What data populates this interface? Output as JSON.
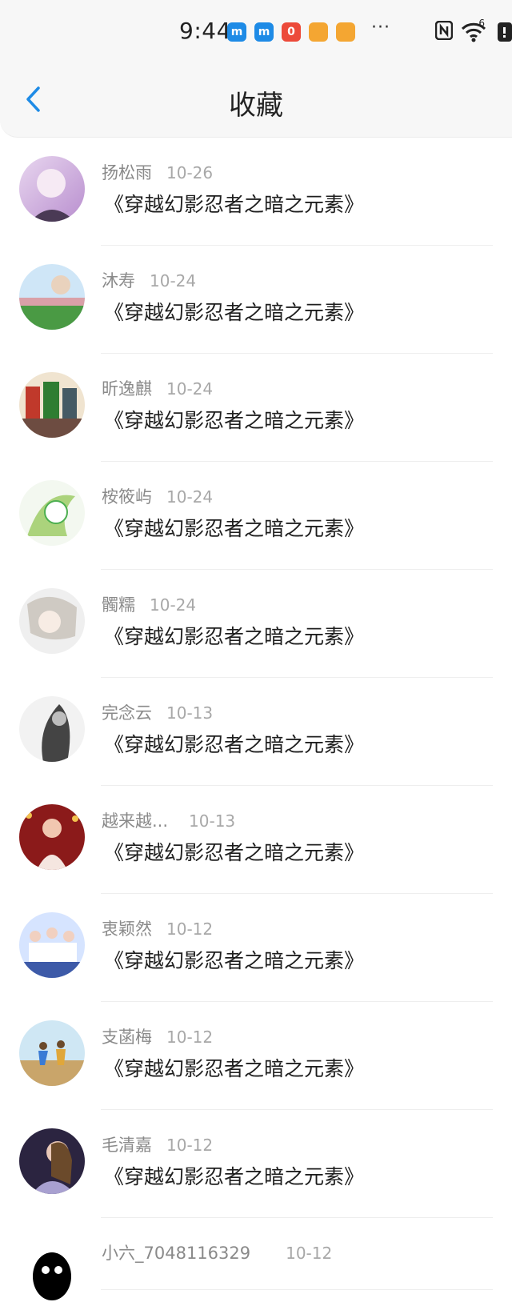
{
  "status_bar": {
    "time": "9:44",
    "notifications": [
      {
        "icon": "maimai-app-icon",
        "glyph": "m",
        "color": "#1e8be6"
      },
      {
        "icon": "maimai-app-icon",
        "glyph": "m",
        "color": "#1e8be6"
      },
      {
        "icon": "red-app-icon",
        "glyph": "0",
        "color": "#ec4a3a"
      },
      {
        "icon": "taobao-app-icon",
        "glyph": "",
        "color": "#f4a632"
      },
      {
        "icon": "taobao-app-icon",
        "glyph": "",
        "color": "#f4a632"
      }
    ],
    "more": "···",
    "signal_label": "6"
  },
  "header": {
    "title": "收藏",
    "back_icon": "chevron-left-icon",
    "accent": "#1e8be6"
  },
  "favorites": [
    {
      "name": "扬松雨",
      "date": "10-26",
      "book": "《穿越幻影忍者之暗之元素》",
      "avatar_colors": [
        "#e8d6ef",
        "#b98fcf"
      ]
    },
    {
      "name": "沐寿",
      "date": "10-24",
      "book": "《穿越幻影忍者之暗之元素》",
      "avatar_colors": [
        "#cfe6f7",
        "#4a9a44"
      ]
    },
    {
      "name": "昕逸麒",
      "date": "10-24",
      "book": "《穿越幻影忍者之暗之元素》",
      "avatar_colors": [
        "#f0e4d0",
        "#c0392b"
      ]
    },
    {
      "name": "桉筱屿",
      "date": "10-24",
      "book": "《穿越幻影忍者之暗之元素》",
      "avatar_colors": [
        "#f3f8f0",
        "#4caf50"
      ]
    },
    {
      "name": "髑糯",
      "date": "10-24",
      "book": "《穿越幻影忍者之暗之元素》",
      "avatar_colors": [
        "#efefef",
        "#b7b3ad"
      ]
    },
    {
      "name": "完念云",
      "date": "10-13",
      "book": "《穿越幻影忍者之暗之元素》",
      "avatar_colors": [
        "#f2f2f2",
        "#444444"
      ]
    },
    {
      "name": "越来越...",
      "date": "10-13",
      "book": "《穿越幻影忍者之暗之元素》",
      "avatar_colors": [
        "#8b1a1a",
        "#3a0c0c"
      ]
    },
    {
      "name": "衷颖然",
      "date": "10-12",
      "book": "《穿越幻影忍者之暗之元素》",
      "avatar_colors": [
        "#d6e4ff",
        "#3d5aa8"
      ]
    },
    {
      "name": "支菡梅",
      "date": "10-12",
      "book": "《穿越幻影忍者之暗之元素》",
      "avatar_colors": [
        "#cfe7f4",
        "#c9a56a"
      ]
    },
    {
      "name": "毛清嘉",
      "date": "10-12",
      "book": "《穿越幻影忍者之暗之元素》",
      "avatar_colors": [
        "#2b2440",
        "#a8a0d0"
      ]
    },
    {
      "name": "小六_7048116329",
      "date": "10-12",
      "book": "",
      "avatar_colors": [
        "#ffffff",
        "#000000"
      ]
    }
  ]
}
